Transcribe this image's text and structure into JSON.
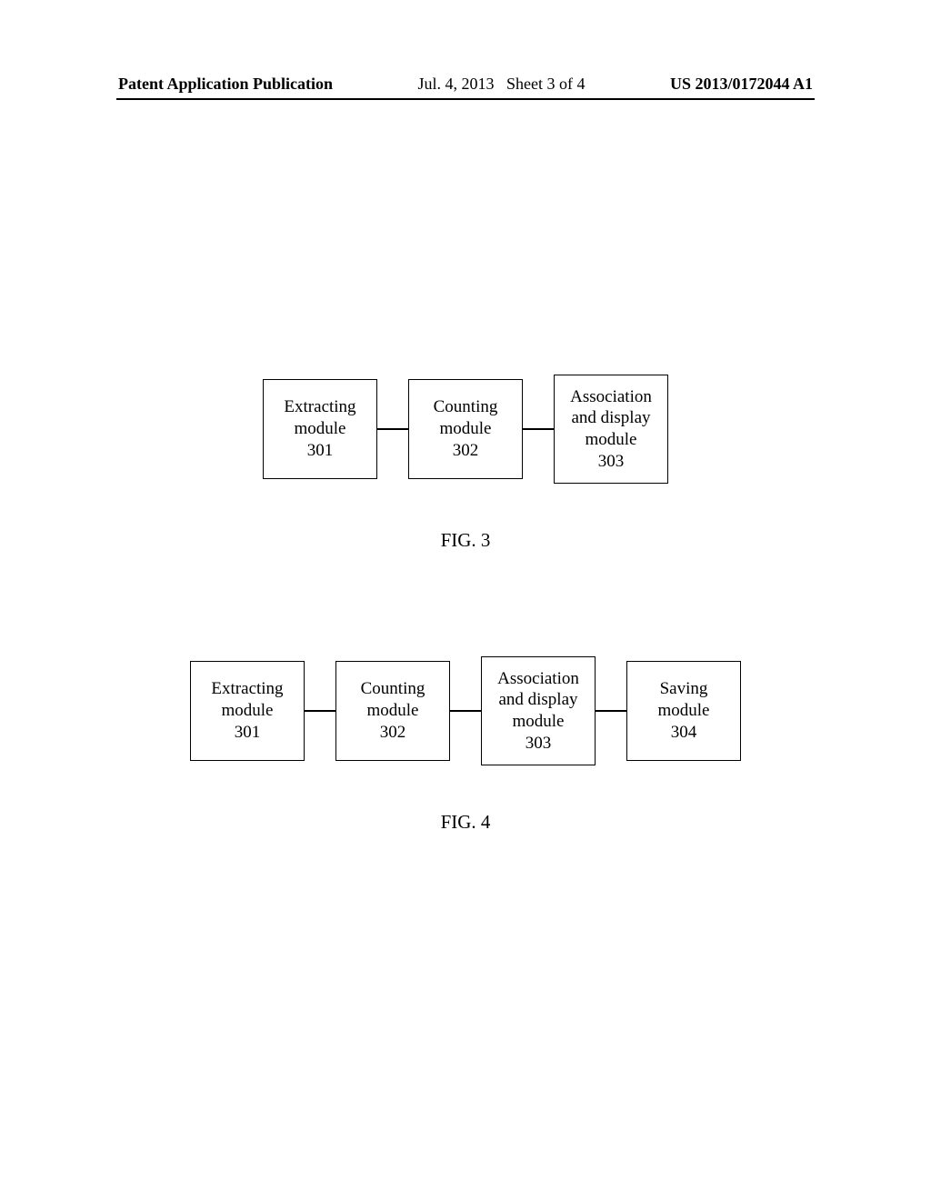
{
  "header": {
    "left": "Patent Application Publication",
    "center_date": "Jul. 4, 2013",
    "center_sheet": "Sheet 3 of 4",
    "right": "US 2013/0172044 A1"
  },
  "figure3": {
    "label": "FIG. 3",
    "modules": [
      {
        "line1": "Extracting",
        "line2": "module",
        "num": "301"
      },
      {
        "line1": "Counting",
        "line2": "module",
        "num": "302"
      },
      {
        "line1": "Association",
        "line2": "and display",
        "line3": "module",
        "num": "303"
      }
    ]
  },
  "figure4": {
    "label": "FIG. 4",
    "modules": [
      {
        "line1": "Extracting",
        "line2": "module",
        "num": "301"
      },
      {
        "line1": "Counting",
        "line2": "module",
        "num": "302"
      },
      {
        "line1": "Association",
        "line2": "and display",
        "line3": "module",
        "num": "303"
      },
      {
        "line1": "Saving",
        "line2": "module",
        "num": "304"
      }
    ]
  }
}
